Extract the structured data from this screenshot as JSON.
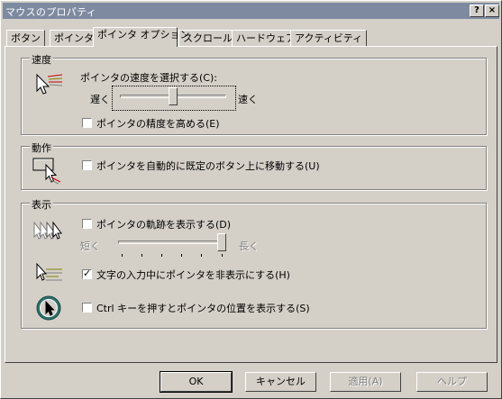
{
  "window": {
    "title": "マウスのプロパティ",
    "help_glyph": "?",
    "close_glyph": "×"
  },
  "tabs": [
    {
      "label": "ボタン"
    },
    {
      "label": "ポインタ"
    },
    {
      "label": "ポインタ オプション",
      "active": true
    },
    {
      "label": "スクロール"
    },
    {
      "label": "ハードウェア"
    },
    {
      "label": "アクティビティ"
    }
  ],
  "speed": {
    "group_label": "速度",
    "select_label": "ポインタの速度を選択する(C):",
    "slow_label": "遅く",
    "fast_label": "速く",
    "slider_value": 0.5,
    "precision_label": "ポインタの精度を高める(E)",
    "precision_checked": false,
    "icon": "pointer-speed-icon"
  },
  "motion": {
    "group_label": "動作",
    "snap_label": "ポインタを自動的に既定のボタン上に移動する(U)",
    "snap_checked": false,
    "icon": "snap-to-button-icon"
  },
  "visibility": {
    "group_label": "表示",
    "trails_label": "ポインタの軌跡を表示する(D)",
    "trails_checked": false,
    "short_label": "短く",
    "long_label": "長く",
    "trails_slider_value": 1.0,
    "hide_typing_label": "文字の入力中にポインタを非表示にする(H)",
    "hide_typing_checked": true,
    "ctrl_label": "Ctrl キーを押すとポインタの位置を表示する(S)",
    "ctrl_checked": false,
    "icons": [
      "pointer-trails-icon",
      "hide-pointer-icon",
      "locate-pointer-icon"
    ]
  },
  "buttons": {
    "ok": "OK",
    "cancel": "キャンセル",
    "apply": "適用(A)",
    "help": "ヘルプ"
  }
}
